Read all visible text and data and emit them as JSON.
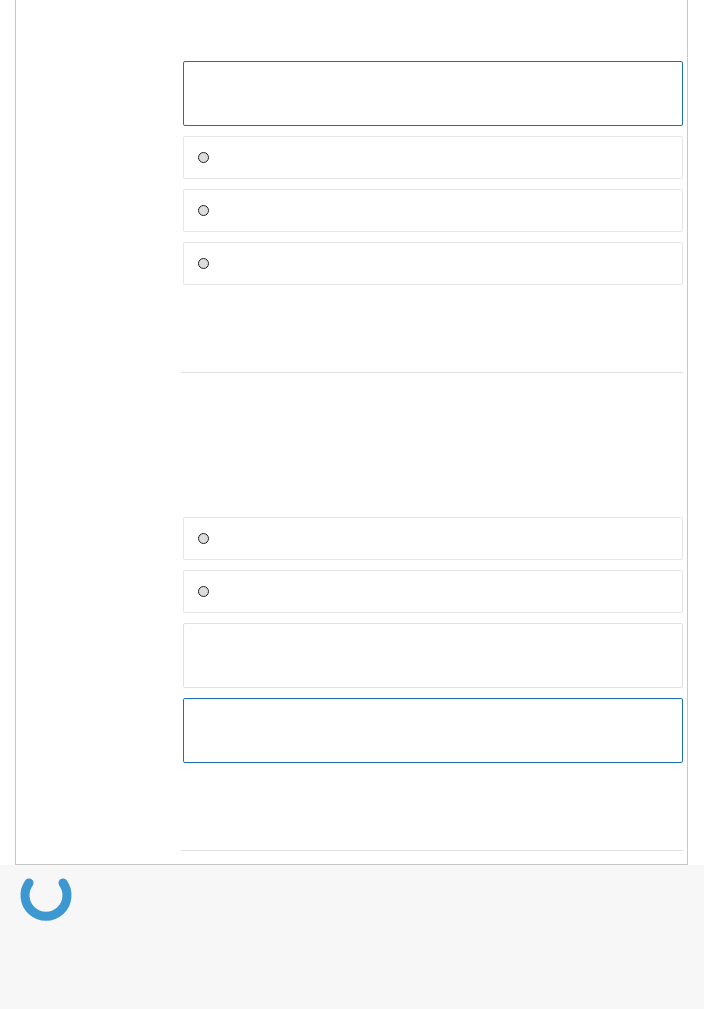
{
  "sections": [
    {
      "items": [
        {
          "kind": "box",
          "focused": true
        },
        {
          "kind": "radio",
          "selected": false
        },
        {
          "kind": "radio",
          "selected": false
        },
        {
          "kind": "radio",
          "selected": false
        }
      ]
    },
    {
      "items": [
        {
          "kind": "radio",
          "selected": false
        },
        {
          "kind": "radio",
          "selected": false
        },
        {
          "kind": "box",
          "focused": false
        },
        {
          "kind": "box",
          "focused": true
        }
      ]
    }
  ],
  "loading": true
}
